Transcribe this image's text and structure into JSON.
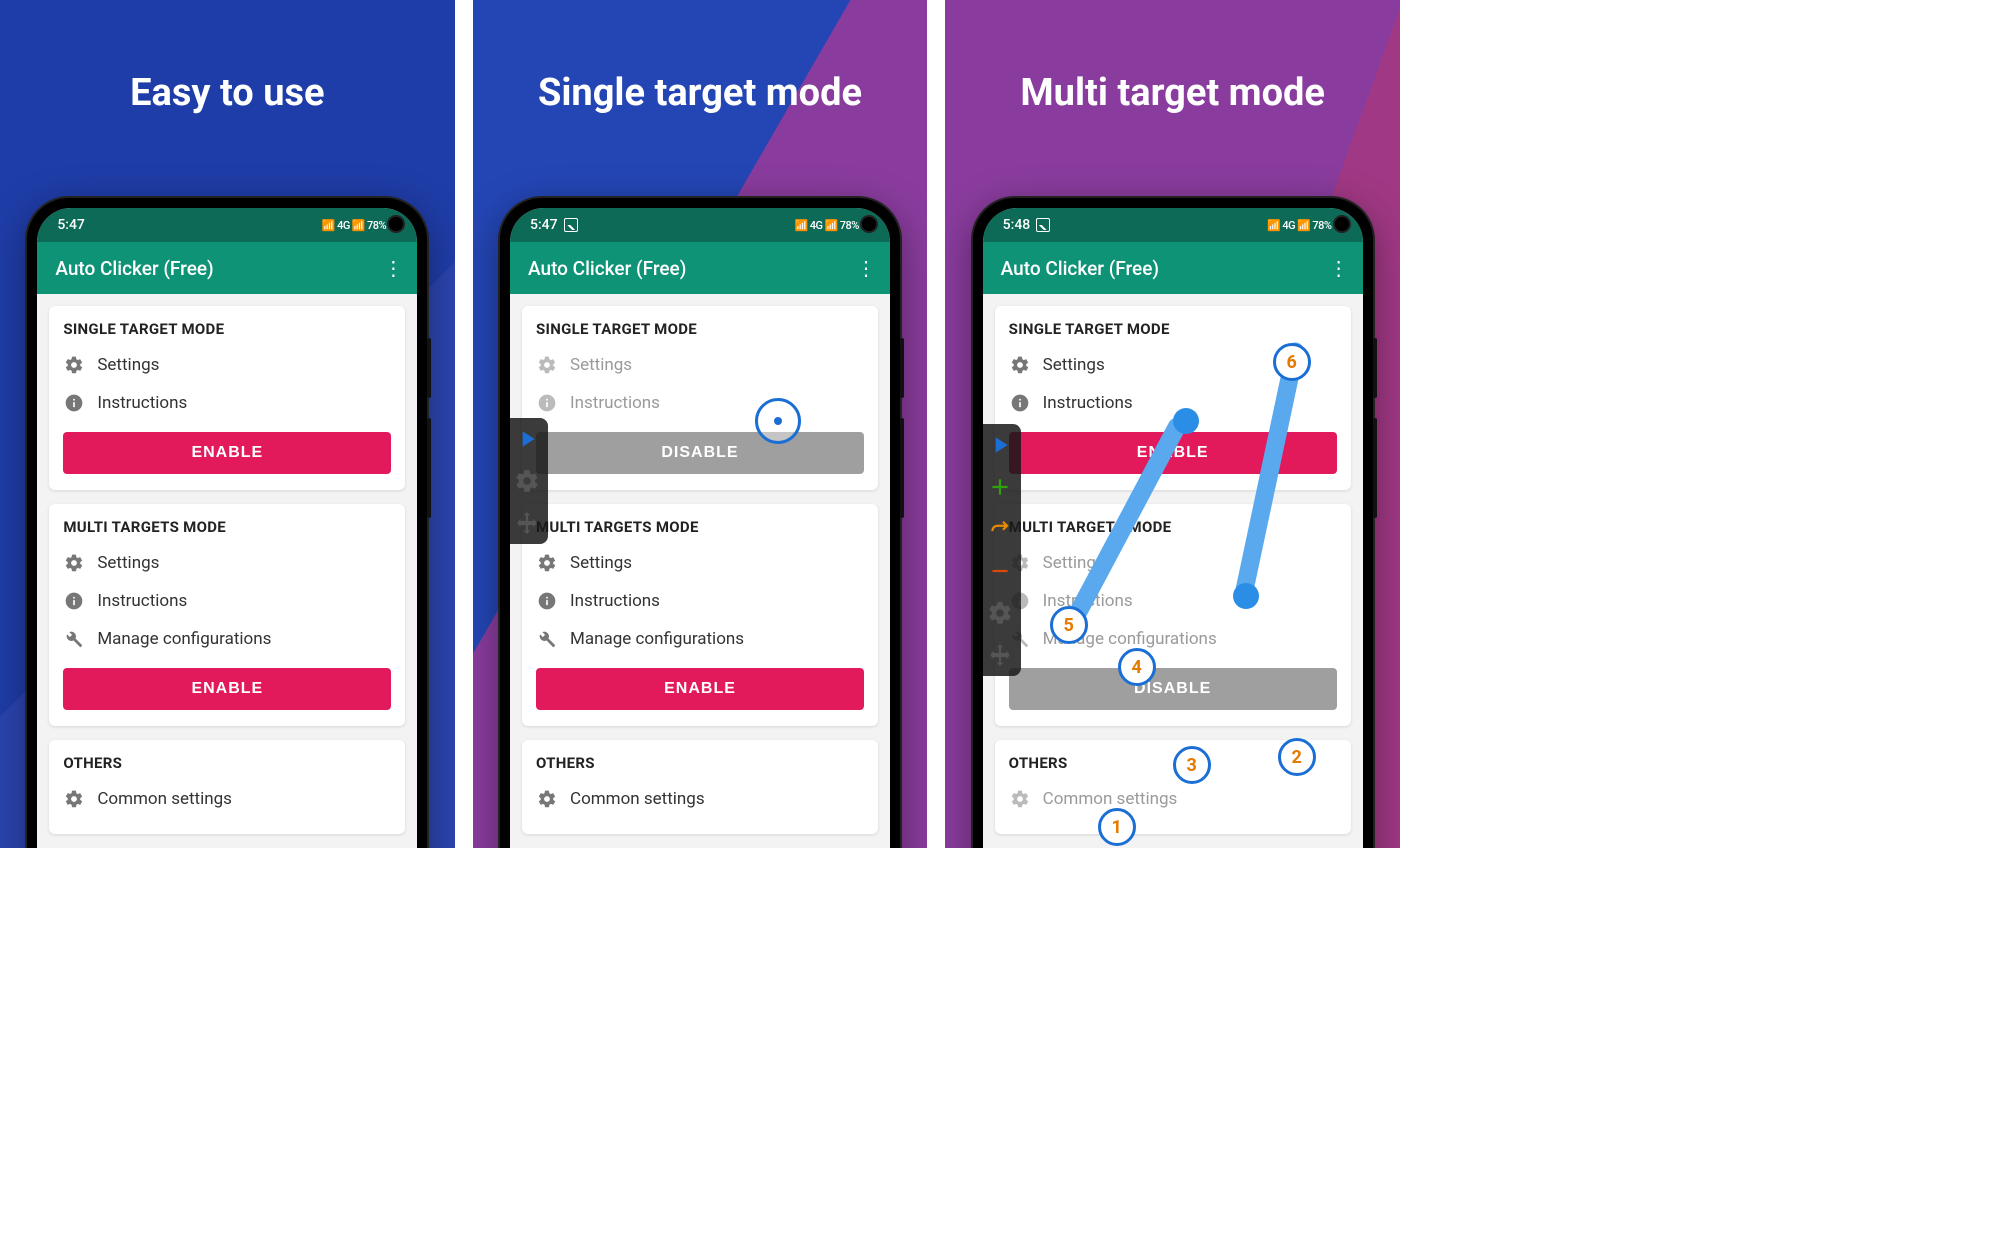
{
  "panels": [
    {
      "caption": "Easy to use"
    },
    {
      "caption": "Single target mode"
    },
    {
      "caption": "Multi target mode"
    }
  ],
  "status": {
    "time_a": "5:47",
    "time_b": "5:47",
    "time_c": "5:48",
    "network": "4G",
    "battery": "78%"
  },
  "app": {
    "title": "Auto Clicker (Free)"
  },
  "single": {
    "title": "SINGLE TARGET MODE",
    "settings": "Settings",
    "instructions": "Instructions",
    "enable": "ENABLE",
    "disable": "DISABLE"
  },
  "multi": {
    "title": "MULTI TARGETS MODE",
    "settings": "Settings",
    "instructions": "Instructions",
    "manage": "Manage configurations",
    "enable": "ENABLE",
    "disable": "DISABLE"
  },
  "others": {
    "title": "OTHERS",
    "common": "Common settings"
  },
  "markers": {
    "m1": "1",
    "m2": "2",
    "m3": "3",
    "m4": "4",
    "m5": "5",
    "m6": "6"
  }
}
